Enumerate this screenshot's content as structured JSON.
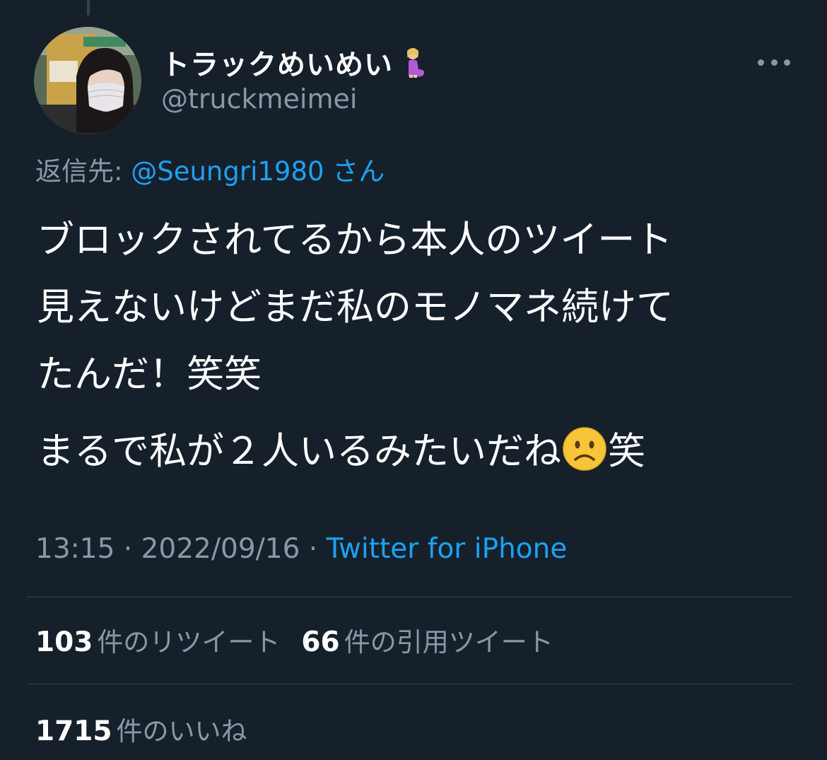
{
  "author": {
    "display_name": "トラックめいめい",
    "badge_icon": "pregnant-woman-emoji",
    "handle": "@truckmeimei"
  },
  "reply_to": {
    "prefix": "返信先: ",
    "mention": "@Seungri1980",
    "suffix": " さん"
  },
  "tweet": {
    "line1": "ブロックされてるから本人のツイート",
    "line2": "見えないけどまだ私のモノマネ続けて",
    "line3": "たんだ！笑笑",
    "line4_text": "まるで私が２人いるみたいだね",
    "line4_emoji": "slightly-frowning-face-emoji",
    "line4_end": "笑"
  },
  "meta": {
    "time": "13:15",
    "separator": " · ",
    "date": "2022/09/16",
    "source": "Twitter for iPhone"
  },
  "stats": {
    "retweets": "103",
    "retweets_label": "件のリツイート",
    "quotes": "66",
    "quotes_label": "件の引用ツイート",
    "likes": "1715",
    "likes_label": "件のいいね"
  },
  "colors": {
    "background": "#15202b",
    "accent": "#1da1f2",
    "secondary_text": "#8899a6",
    "divider": "#38444d"
  }
}
